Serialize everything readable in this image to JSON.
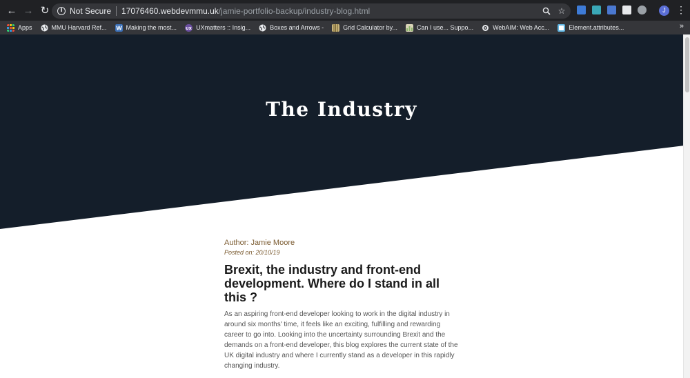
{
  "browser": {
    "back_icon": "arrow-left-icon",
    "forward_icon": "arrow-right-icon",
    "reload_icon": "reload-icon",
    "security_label": "Not Secure",
    "url_host": "17076460.webdevmmu.uk",
    "url_path": "/jamie-portfolio-backup/industry-blog.html",
    "avatar_letter": "J"
  },
  "bookmarks": {
    "items": [
      {
        "label": "Apps",
        "icon": "apps-grid-icon",
        "color": "#e74c3c"
      },
      {
        "label": "MMU Harvard Ref...",
        "icon": "globe-icon",
        "color": "#e8eaed"
      },
      {
        "label": "Making the most...",
        "icon": "w-logo-icon",
        "color": "#3b6fb6"
      },
      {
        "label": "UXmatters :: Insig...",
        "icon": "ux-logo-icon",
        "color": "#6b4fa0"
      },
      {
        "label": "Boxes and Arrows -",
        "icon": "globe-icon",
        "color": "#e8eaed"
      },
      {
        "label": "Grid Calculator by...",
        "icon": "grid-icon",
        "color": "#c8b47a"
      },
      {
        "label": "Can I use... Suppo...",
        "icon": "caniuse-icon",
        "color": "#8bb46a"
      },
      {
        "label": "WebAIM: Web Acc...",
        "icon": "gear-icon",
        "color": "#e8eaed"
      },
      {
        "label": "Element.attributes...",
        "icon": "mdn-icon",
        "color": "#5fb3e0"
      }
    ]
  },
  "colors": {
    "hero_bg": "#141e2a",
    "accent": "#7a5a2f"
  },
  "hero": {
    "title": "The Industry"
  },
  "article": {
    "author": "Author: Jamie Moore",
    "posted": "Posted on: 20/10/19",
    "headline": "Brexit, the industry and front-end development. Where do I stand in all this ?",
    "body": "As an aspiring front-end developer looking to work in the digital industry in around six months' time, it feels like an exciting, fulfilling and rewarding career to go into. Looking into the uncertainty surrounding Brexit and the demands on a front-end developer, this blog explores the current state of the UK digital industry and where I currently stand as a developer in this rapidly changing industry."
  }
}
